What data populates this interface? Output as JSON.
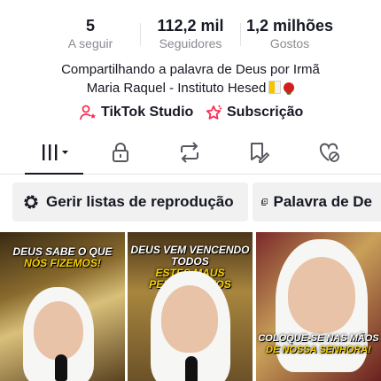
{
  "stats": [
    {
      "value": "5",
      "label": "A seguir"
    },
    {
      "value": "112,2 mil",
      "label": "Seguidores"
    },
    {
      "value": "1,2 milhões",
      "label": "Gostos"
    }
  ],
  "bio": {
    "line1": "Compartilhando a palavra de Deus por Irmã",
    "line2": "Maria Raquel - Instituto Hesed"
  },
  "links": {
    "studio": "TikTok Studio",
    "subscription": "Subscrição"
  },
  "tabs": [
    {
      "icon": "videos-grid-icon",
      "active": true
    },
    {
      "icon": "lock-icon",
      "active": false
    },
    {
      "icon": "repost-icon",
      "active": false
    },
    {
      "icon": "favorites-bookmark-icon",
      "active": false
    },
    {
      "icon": "liked-heart-icon",
      "active": false
    }
  ],
  "chips": {
    "playlists": "Gerir listas de reprodução",
    "playlist2": "Palavra de De"
  },
  "videos": [
    {
      "caption_white": "DEUS SABE O QUE",
      "caption_yellow": "NÓS FIZEMOS!"
    },
    {
      "caption_white": "DEUS VEM VENCENDO TODOS",
      "caption_yellow": "ESTES MAUS PENSAMENTOS"
    },
    {
      "caption_white": "COLOQUE-SE NAS MÃOS",
      "caption_yellow": "DE NOSSA SENHORA!"
    }
  ],
  "colors": {
    "accent": "#fe2c55",
    "text": "#161823",
    "muted": "#8a8b91",
    "chip_bg": "#f1f1f2",
    "caption_yellow": "#f7d000"
  }
}
